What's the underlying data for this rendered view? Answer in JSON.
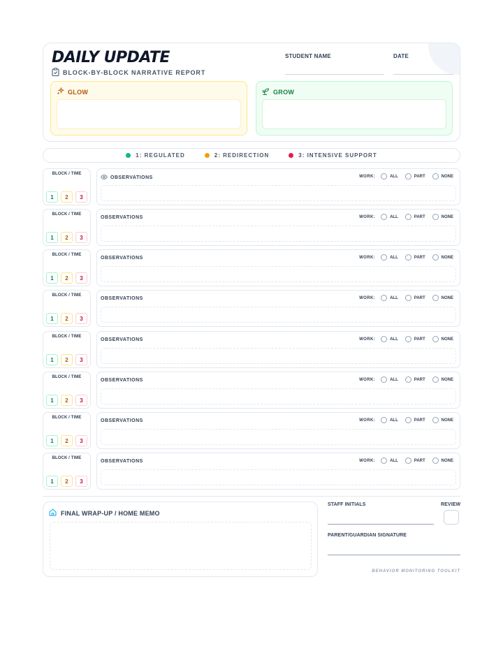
{
  "header": {
    "title": "DAILY UPDATE",
    "subtitle": "BLOCK-BY-BLOCK NARRATIVE REPORT",
    "student_name_label": "STUDENT NAME",
    "date_label": "DATE"
  },
  "glow": {
    "title": "GLOW"
  },
  "grow": {
    "title": "GROW"
  },
  "legend": [
    {
      "label": "1: REGULATED",
      "color": "#10b981"
    },
    {
      "label": "2: REDIRECTION",
      "color": "#f59e0b"
    },
    {
      "label": "3: INTENSIVE SUPPORT",
      "color": "#e11d48"
    }
  ],
  "block_row": {
    "block_label": "BLOCK / TIME",
    "levels": [
      "1",
      "2",
      "3"
    ],
    "observations_label": "OBSERVATIONS",
    "work_label": "WORK:",
    "work_options": [
      "ALL",
      "PART",
      "NONE"
    ]
  },
  "wrap_up": {
    "title": "FINAL WRAP-UP / HOME MEMO"
  },
  "signoff": {
    "staff_initials_label": "STAFF INITIALS",
    "review_label": "REVIEW",
    "parent_signature_label": "PARENT/GUARDIAN SIGNATURE"
  },
  "footer": "BEHAVIOR MONITORING TOOLKIT",
  "colors": {
    "regulated": "#10b981",
    "redirection": "#f59e0b",
    "intensive": "#e11d48",
    "glow_accent": "#b45309",
    "grow_accent": "#15803d"
  },
  "icons": {
    "subtitle": "clipboard-icon",
    "glow": "sparkles-icon",
    "grow": "sprout-icon",
    "observations_first_row": "eye-icon",
    "wrap_up": "home-icon"
  }
}
